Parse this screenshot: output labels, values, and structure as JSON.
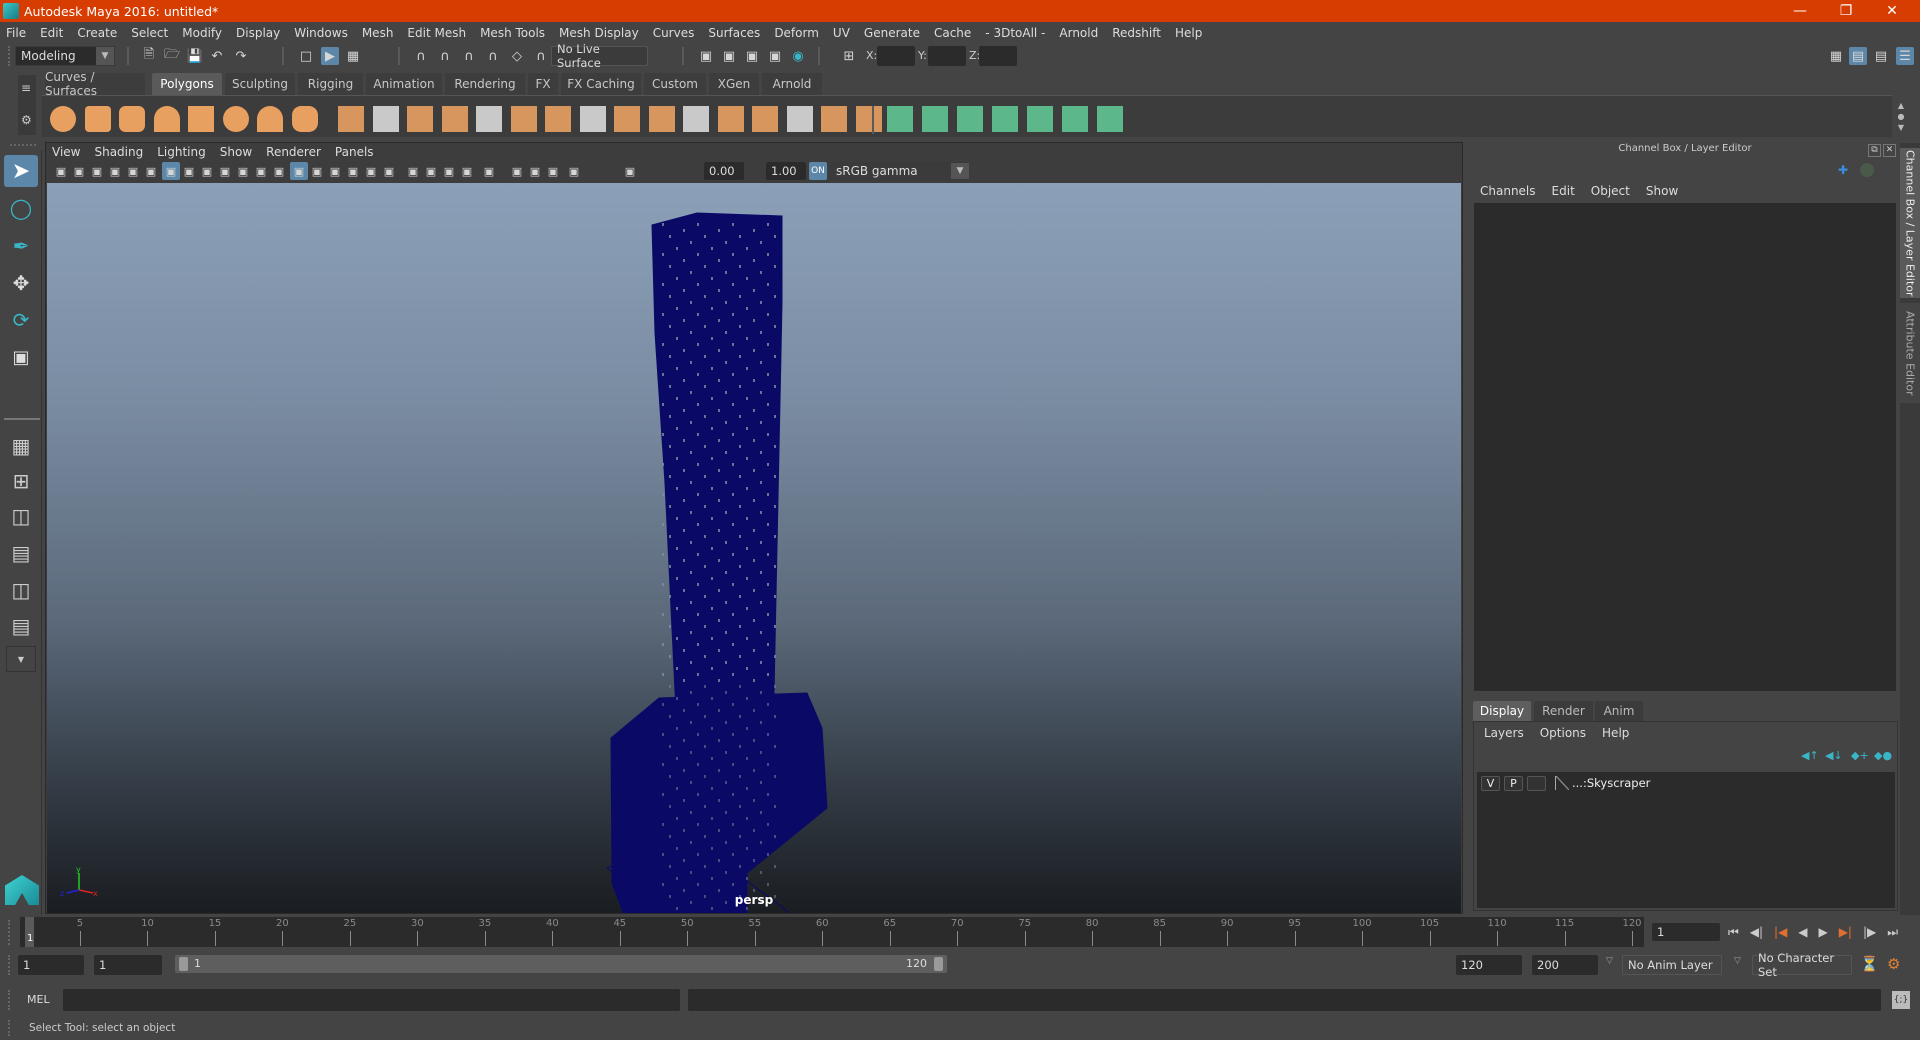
{
  "window": {
    "title": "Autodesk Maya 2016: untitled*",
    "controls": [
      "minimize",
      "restore",
      "close"
    ]
  },
  "menubar": [
    "File",
    "Edit",
    "Create",
    "Select",
    "Modify",
    "Display",
    "Windows",
    "Mesh",
    "Edit Mesh",
    "Mesh Tools",
    "Mesh Display",
    "Curves",
    "Surfaces",
    "Deform",
    "UV",
    "Generate",
    "Cache",
    "- 3DtoAll -",
    "Arnold",
    "Redshift",
    "Help"
  ],
  "statusline": {
    "menuset": "Modeling",
    "live_surface": "No Live Surface",
    "x_label": "X:",
    "y_label": "Y:",
    "z_label": "Z:",
    "x_value": "",
    "y_value": "",
    "z_value": ""
  },
  "shelf": {
    "tabs": [
      "Curves / Surfaces",
      "Polygons",
      "Sculpting",
      "Rigging",
      "Animation",
      "Rendering",
      "FX",
      "FX Caching",
      "Custom",
      "XGen",
      "Arnold"
    ],
    "active_tab": "Polygons",
    "icons": [
      "poly-sphere-icon",
      "poly-cube-icon",
      "poly-cylinder-icon",
      "poly-cone-icon",
      "poly-plane-icon",
      "poly-torus-icon",
      "poly-pyramid-icon",
      "poly-pipe-icon",
      "combine-icon",
      "separate-icon",
      "mirror-icon",
      "smooth-icon",
      "extrude-icon",
      "bridge-icon",
      "multi-cut-icon",
      "bevel-icon",
      "target-weld-icon",
      "insert-edge-loop-icon",
      "bevel-cube-icon",
      "edge-ring-icon",
      "edge-loop-icon",
      "fill-hole-icon",
      "merge-icon",
      "frame-icon"
    ],
    "uv_icons": [
      "planar-map-icon",
      "cylindrical-map-icon",
      "spherical-map-icon",
      "automatic-map-icon",
      "contour-stretch-icon",
      "uv-editor-icon",
      "unfold-icon"
    ]
  },
  "toolbox": {
    "tools": [
      "select-tool",
      "lasso-tool",
      "paint-select-tool",
      "move-tool",
      "rotate-tool",
      "scale-tool"
    ],
    "active_tool": "select-tool",
    "layouts": [
      "single-pane-layout",
      "four-pane-layout",
      "outliner-persp-layout",
      "graph-persp-layout",
      "outliner-hypershade-layout",
      "persp-graph-outliner-layout",
      "more-layouts"
    ]
  },
  "viewport": {
    "menu": [
      "View",
      "Shading",
      "Lighting",
      "Show",
      "Renderer",
      "Panels"
    ],
    "exposure": "0.00",
    "gamma": "1.00",
    "color_space": "sRGB gamma",
    "camera": "persp",
    "wire_color": "#0a0a66"
  },
  "channel_box": {
    "title": "Channel Box / Layer Editor",
    "menu": [
      "Channels",
      "Edit",
      "Object",
      "Show"
    ]
  },
  "layer_editor": {
    "tabs": [
      "Display",
      "Render",
      "Anim"
    ],
    "active_tab": "Display",
    "menu": [
      "Layers",
      "Options",
      "Help"
    ],
    "layers": [
      {
        "visible": "V",
        "playback": "P",
        "name": "...:Skyscraper"
      }
    ]
  },
  "side_tabs": [
    "Channel Box / Layer Editor",
    "Attribute Editor"
  ],
  "timeline": {
    "ticks": [
      5,
      10,
      15,
      20,
      25,
      30,
      35,
      40,
      45,
      50,
      55,
      60,
      65,
      70,
      75,
      80,
      85,
      90,
      95,
      100,
      105,
      110,
      115,
      120
    ],
    "start": 1,
    "end": 120,
    "current_frame_marker": "1",
    "current_frame": "1"
  },
  "range": {
    "start_time": "1",
    "playback_start": "1",
    "slider_start": "1",
    "slider_end": "120",
    "playback_end": "120",
    "end_time": "200",
    "anim_layer": "No Anim Layer",
    "character_set": "No Character Set"
  },
  "commandline": {
    "label": "MEL",
    "input": "",
    "output": ""
  },
  "helpline": "Select Tool: select an object",
  "colors": {
    "titlebar": "#d73c00",
    "accent": "#5c87a8",
    "shelf_orange": "#e8a060",
    "shelf_green": "#5cb88a"
  }
}
